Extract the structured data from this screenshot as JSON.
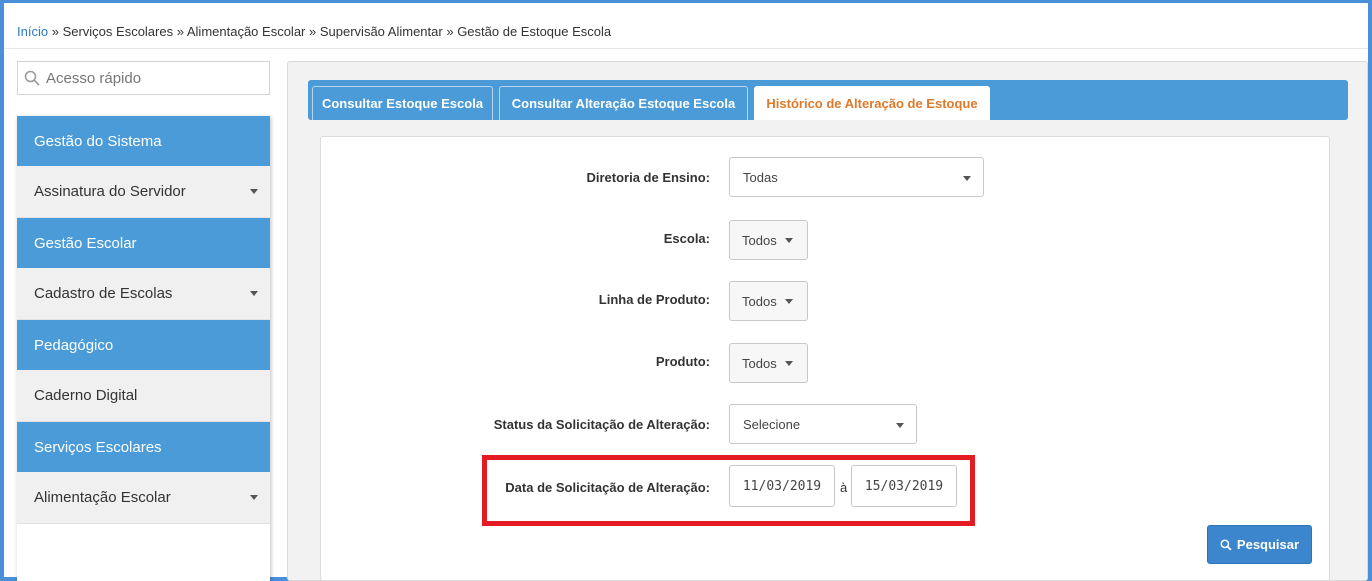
{
  "breadcrumb": {
    "items": [
      "Início",
      "Serviços Escolares",
      "Alimentação Escolar",
      "Supervisão Alimentar",
      "Gestão de Estoque Escola"
    ],
    "separator": "»"
  },
  "quick_access": {
    "placeholder": "Acesso rápido",
    "icon": "search-icon"
  },
  "sidebar": {
    "sections": [
      {
        "header": "Gestão do Sistema",
        "items": [
          {
            "label": "Assinatura do Servidor",
            "expandable": true
          }
        ]
      },
      {
        "header": "Gestão Escolar",
        "items": [
          {
            "label": "Cadastro de Escolas",
            "expandable": true
          }
        ]
      },
      {
        "header": "Pedagógico",
        "items": [
          {
            "label": "Caderno Digital",
            "expandable": false
          }
        ]
      },
      {
        "header": "Serviços Escolares",
        "items": [
          {
            "label": "Alimentação Escolar",
            "expandable": true
          }
        ]
      }
    ]
  },
  "tabs": [
    {
      "label": "Consultar Estoque Escola",
      "active": false
    },
    {
      "label": "Consultar Alteração Estoque Escola",
      "active": false
    },
    {
      "label": "Histórico de Alteração de Estoque",
      "active": true
    }
  ],
  "form": {
    "diretoria": {
      "label": "Diretoria de Ensino:",
      "value": "Todas"
    },
    "escola": {
      "label": "Escola:",
      "value": "Todos"
    },
    "linha": {
      "label": "Linha de Produto:",
      "value": "Todos"
    },
    "produto": {
      "label": "Produto:",
      "value": "Todos"
    },
    "status": {
      "label": "Status da Solicitação de Alteração:",
      "value": "Selecione"
    },
    "data": {
      "label": "Data de Solicitação de Alteração:",
      "from": "11/03/2019",
      "between": "à",
      "to": "15/03/2019"
    }
  },
  "search_button": {
    "label": "Pesquisar",
    "icon": "search-icon"
  },
  "colors": {
    "primary": "#4a9bd7",
    "active_tab_text": "#e07a2a",
    "highlight": "#e41b23",
    "link": "#2a7ac6",
    "button": "#3b86cc"
  }
}
